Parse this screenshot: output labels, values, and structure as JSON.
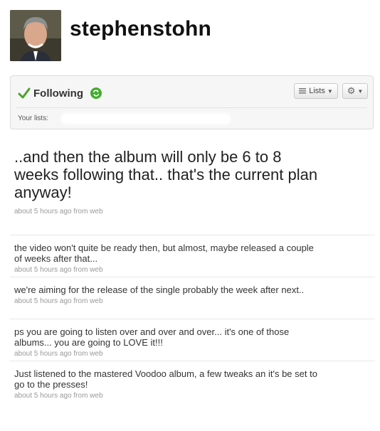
{
  "profile": {
    "username": "stephenstohn"
  },
  "follow": {
    "status_label": "Following",
    "lists_button": "Lists",
    "your_lists_label": "Your lists:"
  },
  "featured_tweet": {
    "text": "..and then the album will only be 6 to 8 weeks following that.. that's the current plan anyway!",
    "meta": "about 5 hours ago from web"
  },
  "tweets": [
    {
      "text": "the video won't quite be ready then, but almost, maybe released a couple of weeks after that...",
      "meta": "about 5 hours ago from web"
    },
    {
      "text": "we're aiming for the release of the single probably the week after next..",
      "meta": "about 5 hours ago from web"
    },
    {
      "text": "ps you are going to listen over and over and over... it's one of those albums... you are going to LOVE it!!!",
      "meta": "about 5 hours ago from web"
    },
    {
      "text": "Just listened to the mastered Voodoo album, a few tweaks an it's be set to go to the presses!",
      "meta": "about 5 hours ago from web"
    }
  ],
  "colors": {
    "check_green": "#4aa32b",
    "retweet_green": "#3fae2a"
  },
  "icons": [
    "check-icon",
    "retweet-icon",
    "list-icon",
    "gear-icon",
    "avatar"
  ]
}
